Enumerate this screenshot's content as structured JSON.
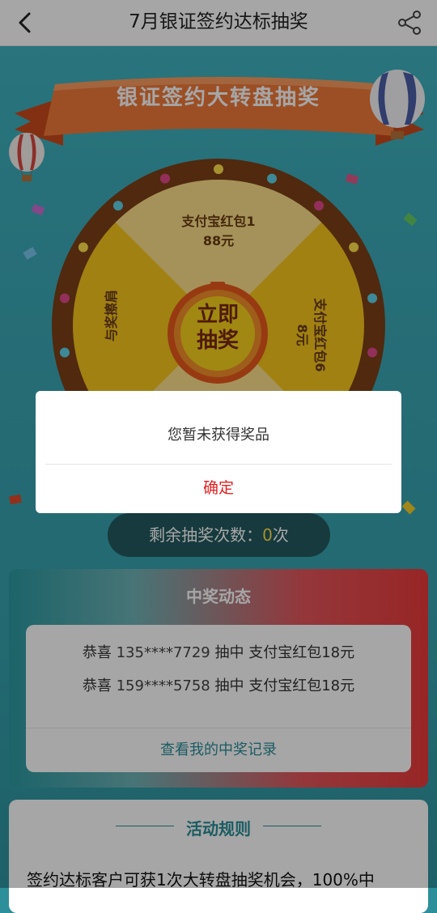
{
  "navbar": {
    "title": "7月银证签约达标抽奖",
    "back_icon": "chevron-left-icon",
    "share_icon": "share-icon"
  },
  "banner": {
    "title": "银证签约大转盘抽奖"
  },
  "wheel": {
    "prize_top_line1": "支付宝红包1",
    "prize_top_line2": "88元",
    "prize_right_line1": "支付宝红包6",
    "prize_right_line2": "8元",
    "prize_left": "与奖擦肩",
    "spin_label_line1": "立即",
    "spin_label_line2": "抽奖"
  },
  "remaining": {
    "label": "剩余抽奖次数：",
    "count": "0",
    "unit": "次"
  },
  "winners": {
    "title": "中奖动态",
    "rows": [
      {
        "prefix": "恭喜",
        "phone": "135****7729",
        "text": "抽中 支付宝红包18元"
      },
      {
        "prefix": "恭喜",
        "phone": "159****5758",
        "text": "抽中 支付宝红包18元"
      }
    ],
    "records_link": "查看我的中奖记录"
  },
  "rules": {
    "title": "活动规则",
    "text": "签约达标客户可获1次大转盘抽奖机会，100%中"
  },
  "dialog": {
    "message": "您暂未获得奖品",
    "confirm": "确定"
  },
  "colors": {
    "accent_teal": "#2b8e98",
    "confirm_red": "#e02020",
    "wheel_gold": "#f5c21a"
  }
}
